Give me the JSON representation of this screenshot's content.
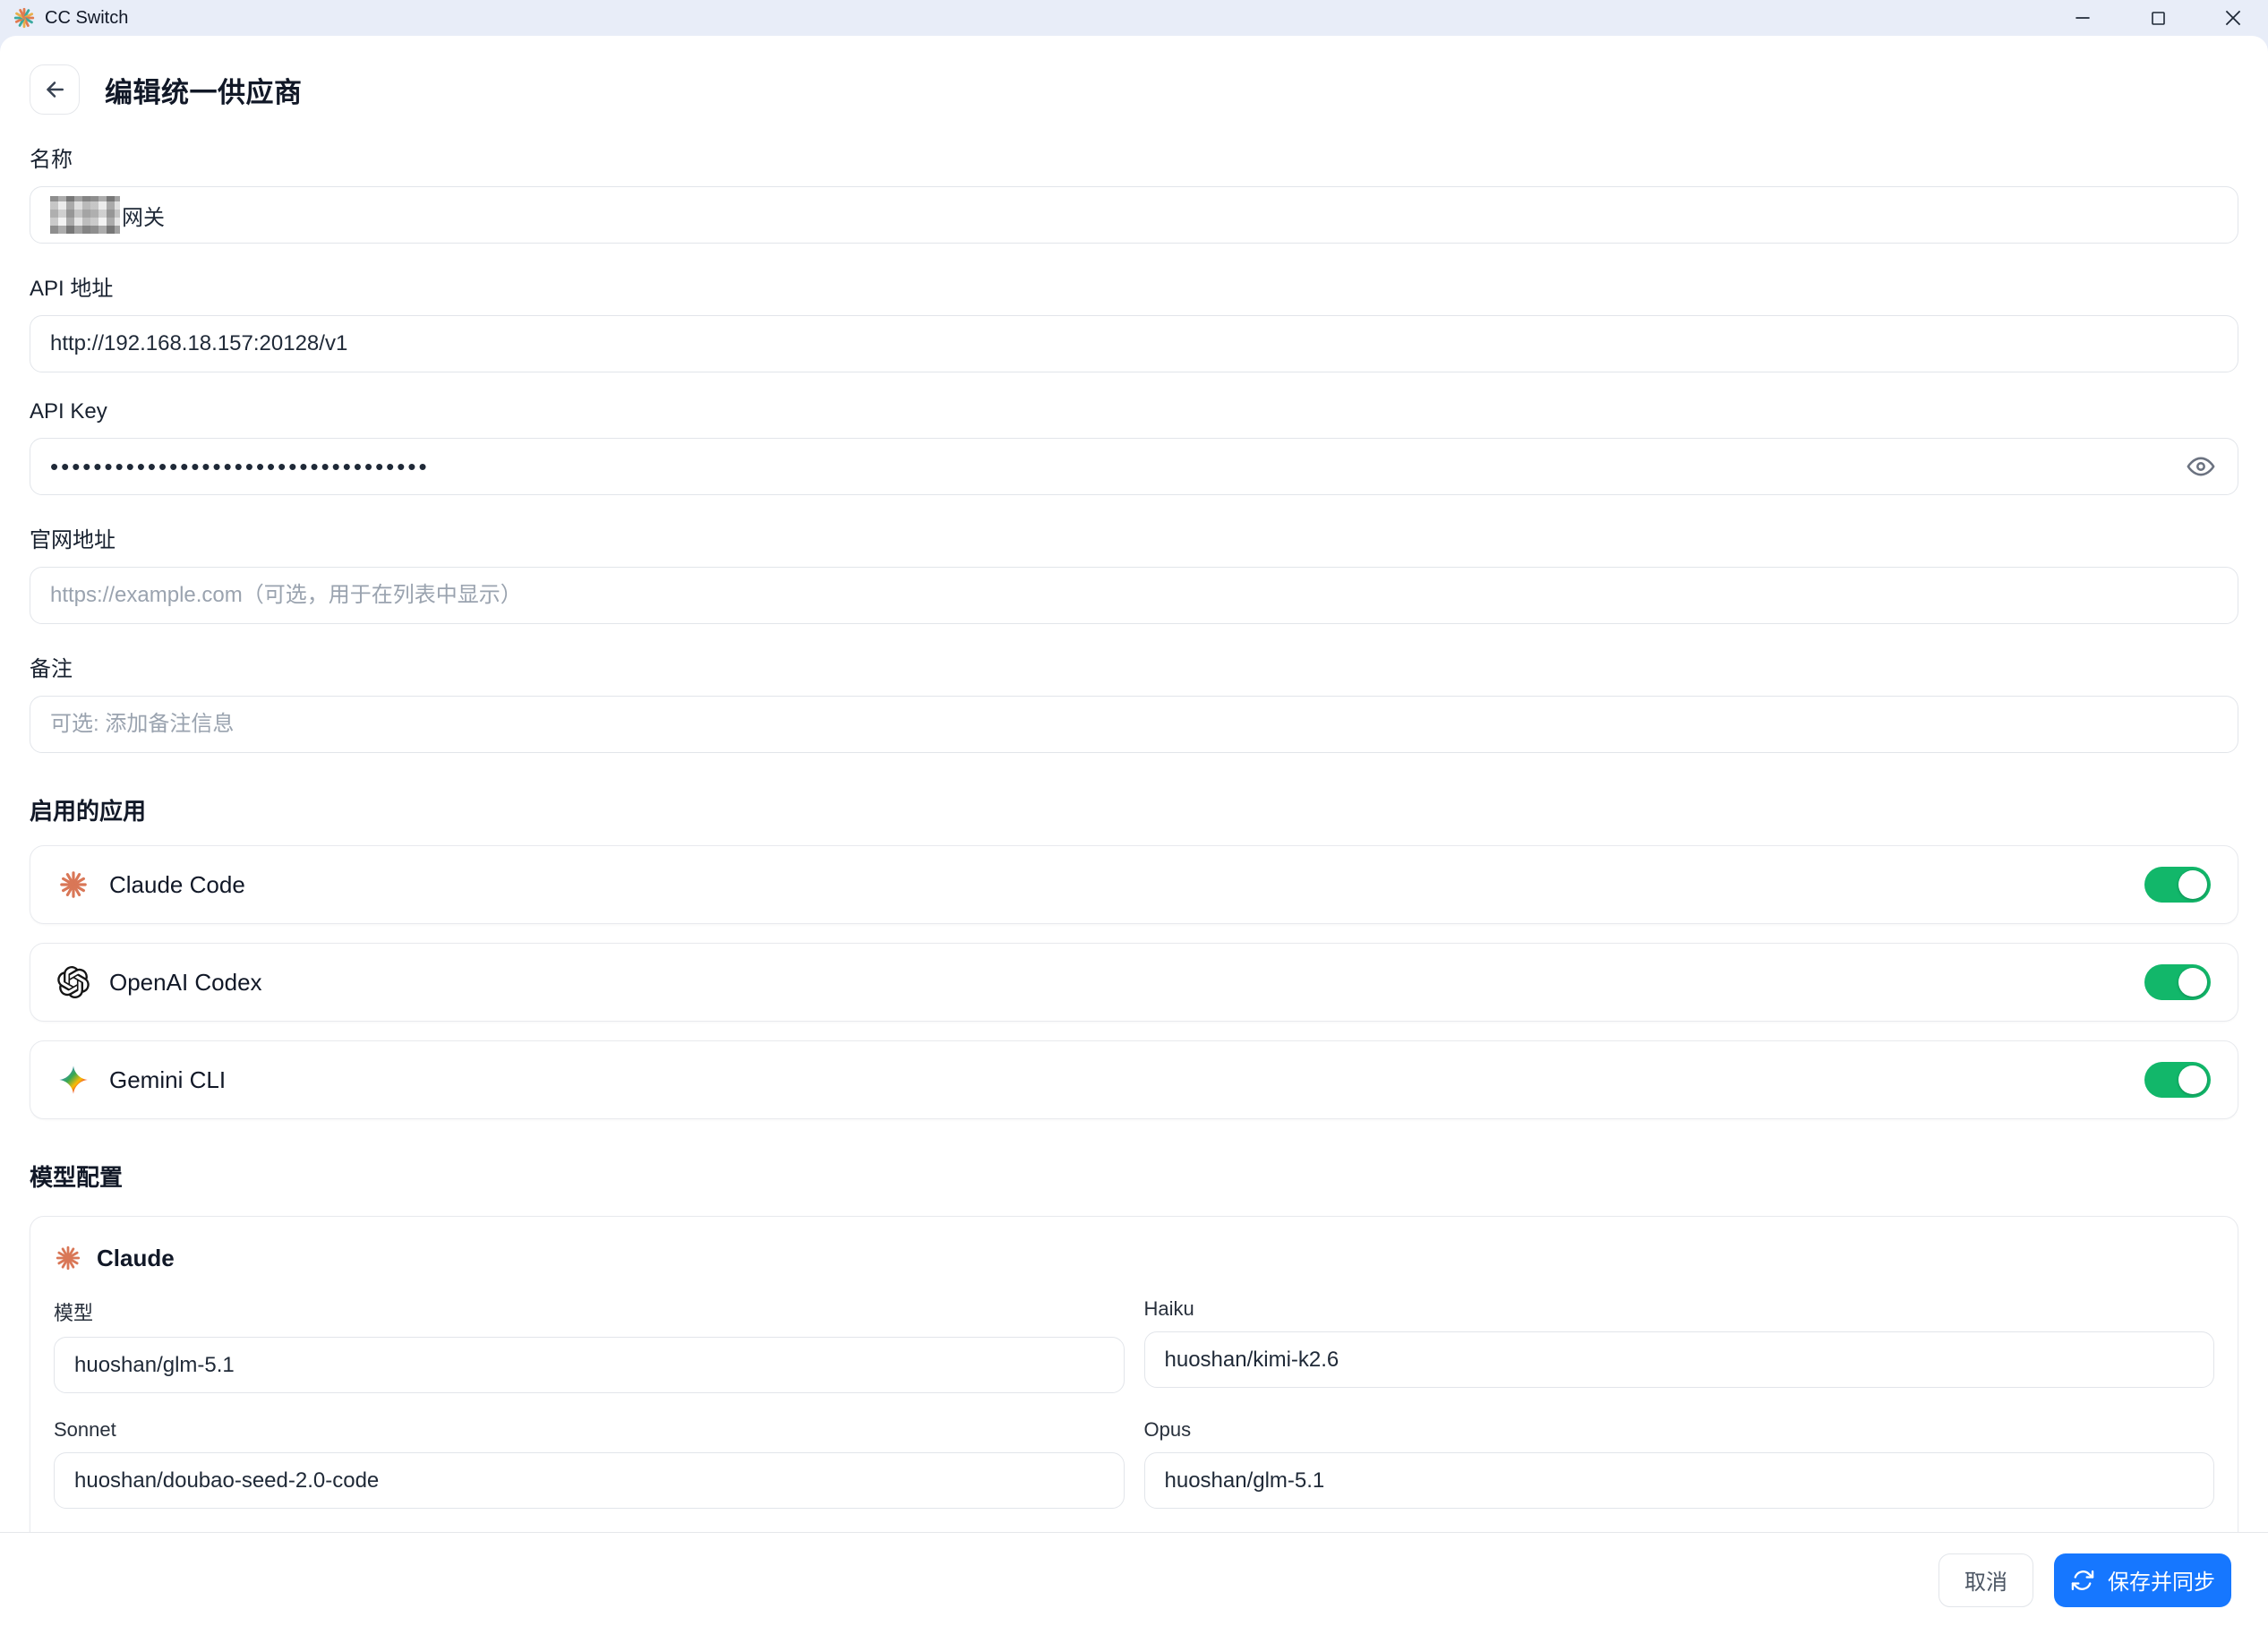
{
  "window": {
    "title": "CC Switch"
  },
  "header": {
    "title": "编辑统一供应商"
  },
  "form": {
    "name": {
      "label": "名称",
      "visible_value": "网关",
      "redacted_prefix": true
    },
    "api_url": {
      "label": "API 地址",
      "value": "http://192.168.18.157:20128/v1"
    },
    "api_key": {
      "label": "API Key",
      "masked_value": "•••••••••••••••••••••••••••••••••••"
    },
    "website": {
      "label": "官网地址",
      "placeholder": "https://example.com（可选，用于在列表中显示）"
    },
    "notes": {
      "label": "备注",
      "placeholder": "可选: 添加备注信息"
    }
  },
  "enabled_apps": {
    "title": "启用的应用",
    "items": [
      {
        "label": "Claude Code",
        "icon": "claude-icon",
        "enabled": true
      },
      {
        "label": "OpenAI Codex",
        "icon": "openai-icon",
        "enabled": true
      },
      {
        "label": "Gemini CLI",
        "icon": "gemini-icon",
        "enabled": true
      }
    ]
  },
  "model_config": {
    "title": "模型配置",
    "card_title": "Claude",
    "fields": [
      {
        "label": "模型",
        "value": "huoshan/glm-5.1"
      },
      {
        "label": "Haiku",
        "value": "huoshan/kimi-k2.6"
      },
      {
        "label": "Sonnet",
        "value": "huoshan/doubao-seed-2.0-code"
      },
      {
        "label": "Opus",
        "value": "huoshan/glm-5.1"
      }
    ]
  },
  "footer": {
    "cancel_label": "取消",
    "save_label": "保存并同步"
  },
  "colors": {
    "accent_blue": "#1677ff",
    "toggle_green": "#12b76a",
    "claude_orange": "#d97757",
    "titlebar_bg": "#e8edf8"
  }
}
